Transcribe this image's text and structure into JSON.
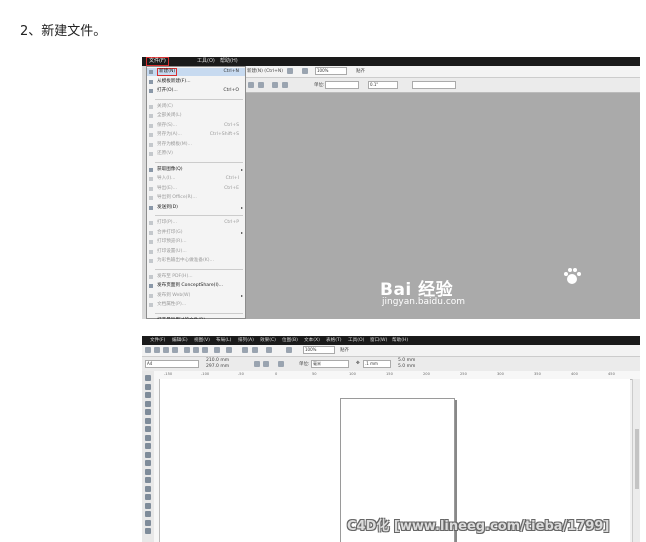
{
  "step_title": "2、新建文件。",
  "screenshot1": {
    "menubar": {
      "file_menu": "文件(F)",
      "tools_menu": "工具(O)",
      "help_menu": "帮助(H)"
    },
    "toolbar": {
      "new_tooltip": "新建(N) (Ctrl+N)",
      "zoom": "100%",
      "snap": "贴齐",
      "units_label": "单位:",
      "nudge": "0.1\""
    },
    "file_menu_items": [
      {
        "label": "新建(N)",
        "shortcut": "Ctrl+N",
        "highlighted": true
      },
      {
        "label": "从模板新建(F)...",
        "shortcut": ""
      },
      {
        "label": "打开(O)...",
        "shortcut": "Ctrl+O"
      },
      {
        "label": "关闭(C)",
        "shortcut": "",
        "disabled": true
      },
      {
        "label": "全部关闭(L)",
        "shortcut": "",
        "disabled": true
      },
      {
        "label": "保存(S)...",
        "shortcut": "Ctrl+S",
        "disabled": true
      },
      {
        "label": "另存为(A)...",
        "shortcut": "Ctrl+Shift+S",
        "disabled": true
      },
      {
        "label": "另存为模板(M)...",
        "shortcut": "",
        "disabled": true
      },
      {
        "label": "还原(V)",
        "shortcut": "",
        "disabled": true
      },
      {
        "label": "获取图像(Q)",
        "shortcut": "",
        "submenu": true
      },
      {
        "label": "导入(I)...",
        "shortcut": "Ctrl+I",
        "disabled": true
      },
      {
        "label": "导出(E)...",
        "shortcut": "Ctrl+E",
        "disabled": true
      },
      {
        "label": "导出到 Office(R)...",
        "shortcut": "",
        "disabled": true
      },
      {
        "label": "发送到(D)",
        "shortcut": "",
        "submenu": true
      },
      {
        "label": "打印(P)...",
        "shortcut": "Ctrl+P",
        "disabled": true
      },
      {
        "label": "合并打印(G)",
        "shortcut": "",
        "disabled": true,
        "submenu": true
      },
      {
        "label": "打印预览(R)...",
        "shortcut": "",
        "disabled": true
      },
      {
        "label": "打印设置(U)...",
        "shortcut": "",
        "disabled": true
      },
      {
        "label": "为彩色输出中心做准备(K)...",
        "shortcut": "",
        "disabled": true
      },
      {
        "label": "发布至 PDF(H)...",
        "shortcut": "",
        "disabled": true
      },
      {
        "label": "发布页面到 ConceptShare(I)...",
        "shortcut": ""
      },
      {
        "label": "发布到 Web(W)",
        "shortcut": "",
        "disabled": true,
        "submenu": true
      },
      {
        "label": "文档属性(P)...",
        "shortcut": "",
        "disabled": true
      },
      {
        "label": "打开最近用过的文件(R)",
        "shortcut": "",
        "submenu": true
      },
      {
        "label": "退出(X)",
        "shortcut": "Alt+F4"
      }
    ],
    "watermark_brand": "Bai  经验",
    "watermark_url": "jingyan.baidu.com"
  },
  "screenshot2": {
    "menubar": [
      "文件(F)",
      "编辑(E)",
      "视图(V)",
      "布局(L)",
      "排列(A)",
      "效果(C)",
      "位图(B)",
      "文本(X)",
      "表格(T)",
      "工具(O)",
      "窗口(W)",
      "帮助(H)"
    ],
    "toolbar": {
      "zoom": "100%",
      "snap": "贴齐",
      "paper": "A4",
      "width": "210.0 mm",
      "height": "297.0 mm",
      "units_label": "单位:",
      "units_value": "毫米",
      "nudge": ".1 mm",
      "dup_x": "5.0 mm",
      "dup_y": "5.0 mm"
    },
    "ruler_ticks": [
      "-150",
      "-100",
      "-50",
      "0",
      "50",
      "100",
      "150",
      "200",
      "250",
      "300",
      "350",
      "400",
      "450"
    ]
  },
  "bottom_watermark": "C4D化  [www.lineeg.com/tieba/1799]",
  "colors": {
    "menubar_bg": "#1a1a1a",
    "highlight_border": "#d83030",
    "workspace_gray": "#aaaaaa",
    "menu_bg": "#f4f4f4"
  }
}
